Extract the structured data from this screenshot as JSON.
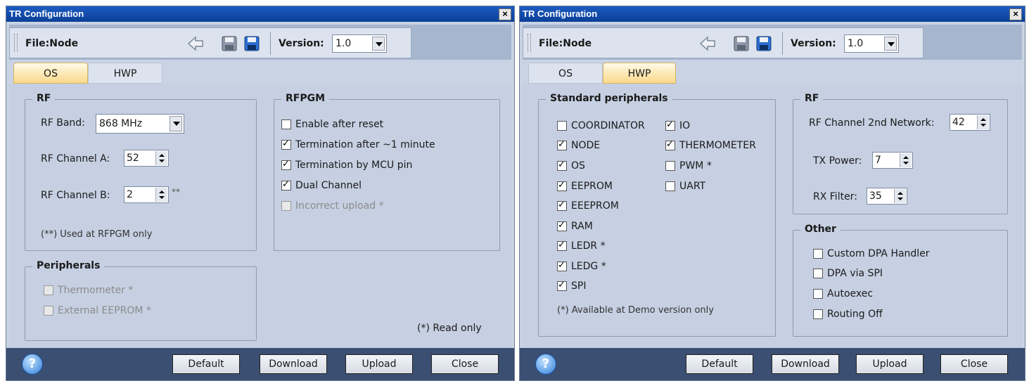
{
  "windows": [
    {
      "title": "TR Configuration",
      "file_label": "File:Node",
      "version_label": "Version:",
      "version_value": "1.0",
      "tabs": [
        "OS",
        "HWP"
      ],
      "active_tab": "OS",
      "rf": {
        "legend": "RF",
        "band_label": "RF Band:",
        "band_value": "868 MHz",
        "channel_a_label": "RF Channel A:",
        "channel_a_value": "52",
        "channel_b_label": "RF Channel B:",
        "channel_b_value": "2",
        "channel_b_mark": "**",
        "note": "(**) Used at RFPGM only"
      },
      "rfpgm": {
        "legend": "RFPGM",
        "items": [
          {
            "label": "Enable after reset",
            "checked": false,
            "disabled": false
          },
          {
            "label": "Termination after ~1 minute",
            "checked": true,
            "disabled": false
          },
          {
            "label": "Termination by MCU pin",
            "checked": true,
            "disabled": false
          },
          {
            "label": "Dual Channel",
            "checked": true,
            "disabled": false
          },
          {
            "label": "Incorrect upload *",
            "checked": false,
            "disabled": true
          }
        ]
      },
      "peripherals": {
        "legend": "Peripherals",
        "items": [
          {
            "label": "Thermometer *",
            "checked": false,
            "disabled": true
          },
          {
            "label": "External EEPROM *",
            "checked": false,
            "disabled": true
          }
        ]
      },
      "read_only_note": "(*) Read only",
      "buttons": {
        "default": "Default",
        "download": "Download",
        "upload": "Upload",
        "close": "Close"
      }
    },
    {
      "title": "TR Configuration",
      "file_label": "File:Node",
      "version_label": "Version:",
      "version_value": "1.0",
      "tabs": [
        "OS",
        "HWP"
      ],
      "active_tab": "HWP",
      "standard_peripherals": {
        "legend": "Standard peripherals",
        "col1": [
          {
            "label": "COORDINATOR",
            "checked": false
          },
          {
            "label": "NODE",
            "checked": true
          },
          {
            "label": "OS",
            "checked": true
          },
          {
            "label": "EEPROM",
            "checked": true
          },
          {
            "label": "EEEPROM",
            "checked": true
          },
          {
            "label": "RAM",
            "checked": true
          },
          {
            "label": "LEDR *",
            "checked": true
          },
          {
            "label": "LEDG *",
            "checked": true
          },
          {
            "label": "SPI",
            "checked": true
          }
        ],
        "col2": [
          {
            "label": "IO",
            "checked": true
          },
          {
            "label": "THERMOMETER",
            "checked": true
          },
          {
            "label": "PWM *",
            "checked": false
          },
          {
            "label": "UART",
            "checked": false
          }
        ],
        "note": "(*) Available at Demo version only"
      },
      "rf": {
        "legend": "RF",
        "channel2_label": "RF Channel 2nd Network:",
        "channel2_value": "42",
        "tx_label": "TX Power:",
        "tx_value": "7",
        "rx_label": "RX Filter:",
        "rx_value": "35"
      },
      "other": {
        "legend": "Other",
        "items": [
          {
            "label": "Custom DPA Handler",
            "checked": false
          },
          {
            "label": "DPA via SPI",
            "checked": false
          },
          {
            "label": "Autoexec",
            "checked": false
          },
          {
            "label": "Routing Off",
            "checked": false
          }
        ]
      },
      "buttons": {
        "default": "Default",
        "download": "Download",
        "upload": "Upload",
        "close": "Close"
      }
    }
  ]
}
